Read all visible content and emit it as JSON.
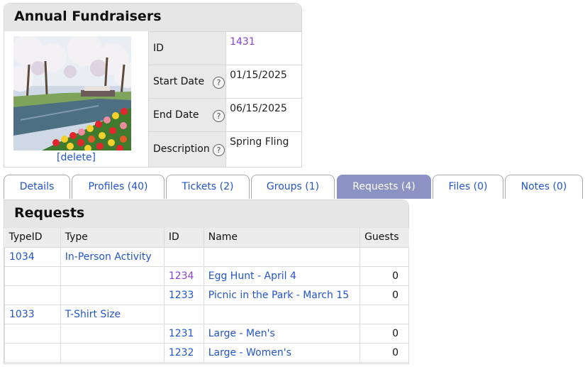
{
  "event": {
    "title": "Annual Fundraisers",
    "delete_label": "[delete]",
    "fields": [
      {
        "label": "ID",
        "value": "1431",
        "help": false
      },
      {
        "label": "Start Date",
        "value": "01/15/2025",
        "help": true
      },
      {
        "label": "End Date",
        "value": "06/15/2025",
        "help": true
      },
      {
        "label": "Description",
        "value": "Spring Fling",
        "help": true
      }
    ],
    "help_glyph": "?"
  },
  "tabs": [
    {
      "label": "Details"
    },
    {
      "label": "Profiles (40)"
    },
    {
      "label": "Tickets (2)"
    },
    {
      "label": "Groups (1)"
    },
    {
      "label": "Requests (4)",
      "active": true
    },
    {
      "label": "Files (0)"
    },
    {
      "label": "Notes (0)"
    }
  ],
  "requests": {
    "title": "Requests",
    "columns": [
      "TypeID",
      "Type",
      "ID",
      "Name",
      "Guests"
    ],
    "rows": [
      {
        "typeid": "1034",
        "type": "In-Person Activity",
        "id": "",
        "name": "",
        "guests": ""
      },
      {
        "typeid": "",
        "type": "",
        "id": "1234",
        "name": "Egg Hunt - April 4",
        "guests": "0"
      },
      {
        "typeid": "",
        "type": "",
        "id": "1233",
        "name": "Picnic in the Park - March 15",
        "guests": "0"
      },
      {
        "typeid": "1033",
        "type": "T-Shirt Size",
        "id": "",
        "name": "",
        "guests": ""
      },
      {
        "typeid": "",
        "type": "",
        "id": "1231",
        "name": "Large - Men's",
        "guests": "0"
      },
      {
        "typeid": "",
        "type": "",
        "id": "1232",
        "name": "Large - Women's",
        "guests": "0"
      }
    ]
  },
  "colors": {
    "link": "#2255cc",
    "visited_link": "#8a3fd1",
    "active_tab": "#8c93c4",
    "header_bg": "#e6e6e6"
  }
}
